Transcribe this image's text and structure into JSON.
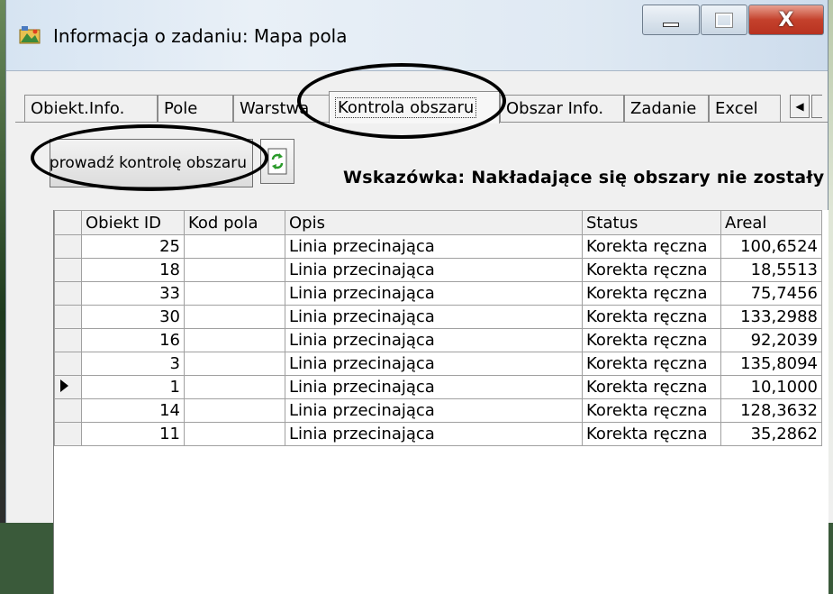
{
  "window": {
    "title": "Informacja o zadaniu: Mapa pola",
    "controls": {
      "minimize_icon": "minimize-icon",
      "maximize_icon": "maximize-icon",
      "close_label": "X"
    }
  },
  "tabs": [
    {
      "label": "Obiekt.Info.",
      "active": false
    },
    {
      "label": "Pole",
      "active": false
    },
    {
      "label": "Warstwa",
      "active": false
    },
    {
      "label": "Kontrola obszaru",
      "active": true
    },
    {
      "label": "Obszar Info.",
      "active": false
    },
    {
      "label": "Zadanie",
      "active": false
    },
    {
      "label": "Excel",
      "active": false
    }
  ],
  "tab_nav": {
    "prev": "◀"
  },
  "toolbar": {
    "run_label": "przeprowadź kontrolę obszaru",
    "refresh_icon": "refresh-icon"
  },
  "hint": "Wskazówka: Nakładające się obszary nie zostały",
  "table": {
    "columns": [
      "Obiekt ID",
      "Kod pola",
      "Opis",
      "Status",
      "Areal"
    ],
    "rows": [
      {
        "id": "25",
        "kod": "",
        "opis": "Linia przecinająca",
        "status": "Korekta ręczna",
        "areal": "100,6524",
        "current": false
      },
      {
        "id": "18",
        "kod": "",
        "opis": "Linia przecinająca",
        "status": "Korekta ręczna",
        "areal": "18,5513",
        "current": false
      },
      {
        "id": "33",
        "kod": "",
        "opis": "Linia przecinająca",
        "status": "Korekta ręczna",
        "areal": "75,7456",
        "current": false
      },
      {
        "id": "30",
        "kod": "",
        "opis": "Linia przecinająca",
        "status": "Korekta ręczna",
        "areal": "133,2988",
        "current": false
      },
      {
        "id": "16",
        "kod": "",
        "opis": "Linia przecinająca",
        "status": "Korekta ręczna",
        "areal": "92,2039",
        "current": false
      },
      {
        "id": "3",
        "kod": "",
        "opis": "Linia przecinająca",
        "status": "Korekta ręczna",
        "areal": "135,8094",
        "current": false
      },
      {
        "id": "1",
        "kod": "",
        "opis": "Linia przecinająca",
        "status": "Korekta ręczna",
        "areal": "10,1000",
        "current": true
      },
      {
        "id": "14",
        "kod": "",
        "opis": "Linia przecinająca",
        "status": "Korekta ręczna",
        "areal": "128,3632",
        "current": false
      },
      {
        "id": "11",
        "kod": "",
        "opis": "Linia przecinająca",
        "status": "Korekta ręczna",
        "areal": "35,2862",
        "current": false
      }
    ]
  }
}
